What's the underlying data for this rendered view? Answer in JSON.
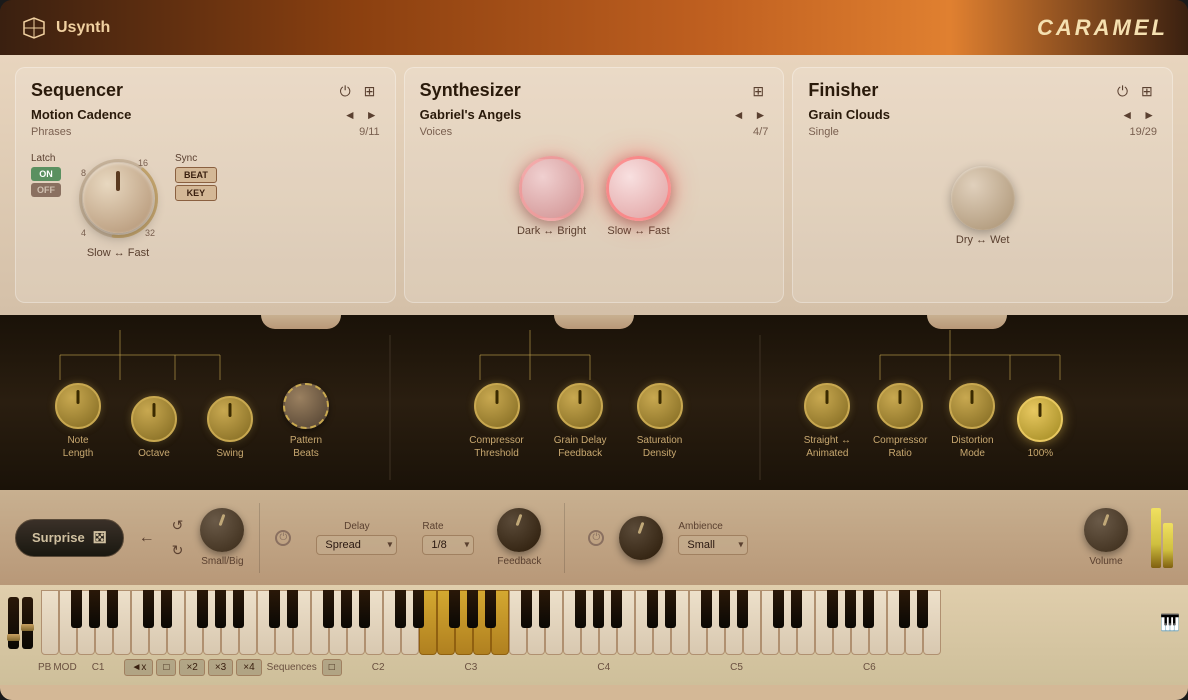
{
  "app": {
    "brand": "Usynth",
    "product": "CARAMEL"
  },
  "sequencer": {
    "title": "Sequencer",
    "preset_name": "Motion Cadence",
    "preset_type": "Phrases",
    "preset_count": "9/11",
    "latch_label": "Latch",
    "latch_on": "ON",
    "latch_off": "OFF",
    "sync_label": "Sync",
    "sync_beat": "BEAT",
    "sync_key": "KEY",
    "knob_label": "Slow ↔ Fast",
    "ring_nums": [
      "8",
      "16",
      "4",
      "32"
    ]
  },
  "synthesizer": {
    "title": "Synthesizer",
    "preset_name": "Gabriel's Angels",
    "preset_type": "Voices",
    "preset_count": "4/7",
    "knob1_label": "Dark ↔ Bright",
    "knob2_label": "Slow ↔ Fast"
  },
  "finisher": {
    "title": "Finisher",
    "preset_name": "Grain Clouds",
    "preset_type": "Single",
    "preset_count": "19/29",
    "knob_label": "Dry ↔ Wet"
  },
  "macros": {
    "group1": [
      {
        "label": "Note\nLength",
        "type": "solid"
      },
      {
        "label": "Octave",
        "type": "solid"
      },
      {
        "label": "Swing",
        "type": "solid"
      },
      {
        "label": "Pattern\nBeats",
        "type": "dashed"
      }
    ],
    "group2": [
      {
        "label": "Compressor\nThreshold",
        "type": "solid"
      },
      {
        "label": "Grain Delay\nFeedback",
        "type": "solid"
      },
      {
        "label": "Saturation\nDensity",
        "type": "solid"
      }
    ],
    "group3": [
      {
        "label": "Straight ↔\nAnimated",
        "type": "solid"
      },
      {
        "label": "Compressor\nRatio",
        "type": "solid"
      },
      {
        "label": "Distortion\nMode",
        "type": "solid"
      },
      {
        "label": "100%",
        "type": "plain"
      }
    ]
  },
  "bottom_controls": {
    "surprise_label": "Surprise",
    "small_big_label": "Small/Big",
    "delay_label": "Delay",
    "delay_value": "Spread",
    "rate_label": "Rate",
    "rate_value": "1/8",
    "feedback_label": "Feedback",
    "ambience_label": "Ambience",
    "ambience_value": "Small",
    "volume_label": "Volume"
  },
  "keyboard": {
    "labels": [
      "PB",
      "MOD",
      "C1",
      "Sequences",
      "C2",
      "C3",
      "C4",
      "C5",
      "C6"
    ],
    "seq_buttons": [
      "◄x",
      "□",
      "×2",
      "×3",
      "×4",
      "□"
    ]
  }
}
